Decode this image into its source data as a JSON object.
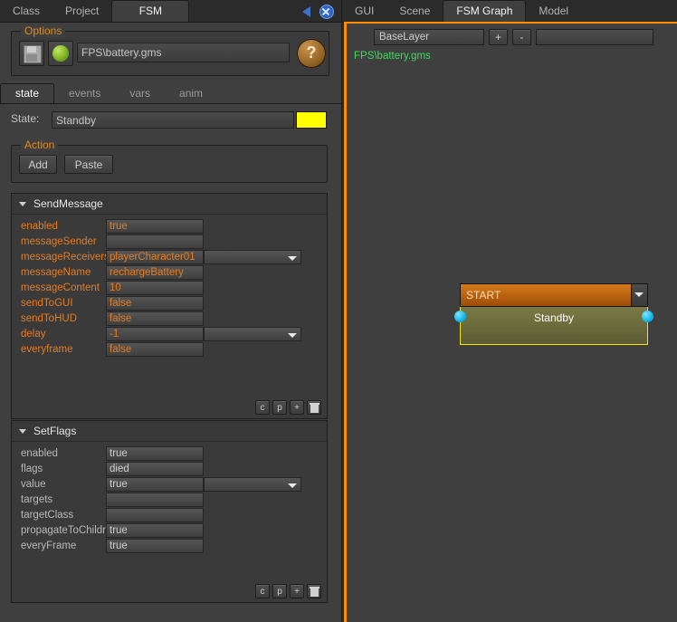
{
  "left_panel": {
    "tabs": [
      {
        "label": "Class",
        "active": false
      },
      {
        "label": "Project",
        "active": false
      },
      {
        "label": "FSM",
        "active": true
      }
    ],
    "tab_icons": [
      {
        "name": "back-triangle-icon"
      },
      {
        "name": "close-circle-icon"
      }
    ],
    "options": {
      "title": "Options",
      "save_icon": "floppy-disk-icon",
      "preview_icon": "green-sphere-icon",
      "file_path": "FPS\\battery.gms",
      "file_path_placeholder": "",
      "help_label": "?"
    },
    "subtabs": [
      {
        "label": "state",
        "active": true
      },
      {
        "label": "events",
        "active": false
      },
      {
        "label": "vars",
        "active": false
      },
      {
        "label": "anim",
        "active": false
      }
    ],
    "state": {
      "label": "State:",
      "value": "Standby",
      "placeholder": "",
      "color_swatch": "#ffff00"
    },
    "action": {
      "title": "Action",
      "add_label": "Add",
      "paste_label": "Paste"
    },
    "mini_buttons": [
      {
        "label": "c",
        "name": "copy-button"
      },
      {
        "label": "p",
        "name": "paste-button"
      },
      {
        "label": "+",
        "name": "add-button"
      },
      {
        "label": "",
        "name": "delete-button"
      }
    ],
    "panels": [
      {
        "title": "SendMessage",
        "label_color": "#e87c1e",
        "rows": [
          {
            "label": "enabled",
            "value": "true",
            "dropdown": false
          },
          {
            "label": "messageSender",
            "value": "",
            "dropdown": false
          },
          {
            "label": "messageReceivers",
            "value": "playerCharacter01",
            "dropdown": true
          },
          {
            "label": "messageName",
            "value": "rechargeBattery",
            "dropdown": false
          },
          {
            "label": "messageContent",
            "value": "10",
            "dropdown": false
          },
          {
            "label": "sendToGUI",
            "value": "false",
            "dropdown": false
          },
          {
            "label": "sendToHUD",
            "value": "false",
            "dropdown": false
          },
          {
            "label": "delay",
            "value": "-1",
            "dropdown": true
          },
          {
            "label": "everyframe",
            "value": "false",
            "dropdown": false
          }
        ]
      },
      {
        "title": "SetFlags",
        "label_color": "#b9b9b9",
        "rows": [
          {
            "label": "enabled",
            "value": "true",
            "dropdown": false
          },
          {
            "label": "flags",
            "value": "died",
            "dropdown": false
          },
          {
            "label": "value",
            "value": "true",
            "dropdown": true
          },
          {
            "label": "targets",
            "value": "",
            "dropdown": false
          },
          {
            "label": "targetClass",
            "value": "",
            "dropdown": false
          },
          {
            "label": "propagateToChildren",
            "value": "true",
            "dropdown": false
          },
          {
            "label": "everyFrame",
            "value": "true",
            "dropdown": false
          }
        ]
      }
    ]
  },
  "right_panel": {
    "tabs": [
      {
        "label": "GUI",
        "active": false
      },
      {
        "label": "Scene",
        "active": false
      },
      {
        "label": "FSM Graph",
        "active": true
      },
      {
        "label": "Model",
        "active": false
      }
    ],
    "toolbar": {
      "layer_value": "BaseLayer",
      "add_label": "+",
      "remove_label": "-",
      "second_combo_value": ""
    },
    "graph_path": "FPS\\battery.gms",
    "node": {
      "header_label": "START",
      "body_label": "Standby",
      "header_color": "#c06a12",
      "border_color": "#f2e500"
    }
  }
}
